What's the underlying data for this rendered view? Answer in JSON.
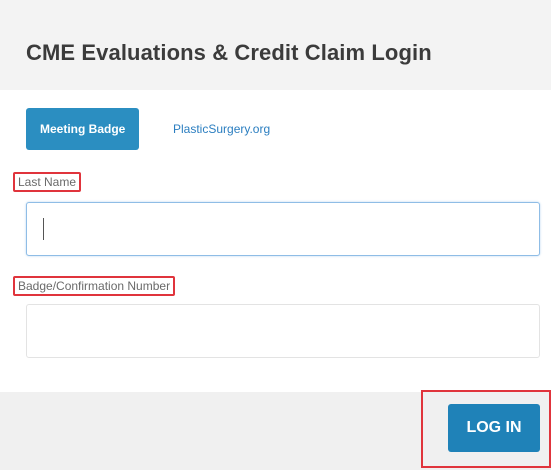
{
  "header": {
    "title": "CME Evaluations & Credit Claim Login"
  },
  "tabs": [
    {
      "label": "Meeting Badge",
      "active": true
    },
    {
      "label": "PlasticSurgery.org",
      "active": false
    }
  ],
  "form": {
    "last_name": {
      "label": "Last Name",
      "value": ""
    },
    "badge_number": {
      "label": "Badge/Confirmation Number",
      "value": ""
    }
  },
  "footer": {
    "login_label": "LOG IN"
  },
  "colors": {
    "accent": "#2b8ec1",
    "button": "#1f82b8",
    "highlight": "#e0343c"
  }
}
